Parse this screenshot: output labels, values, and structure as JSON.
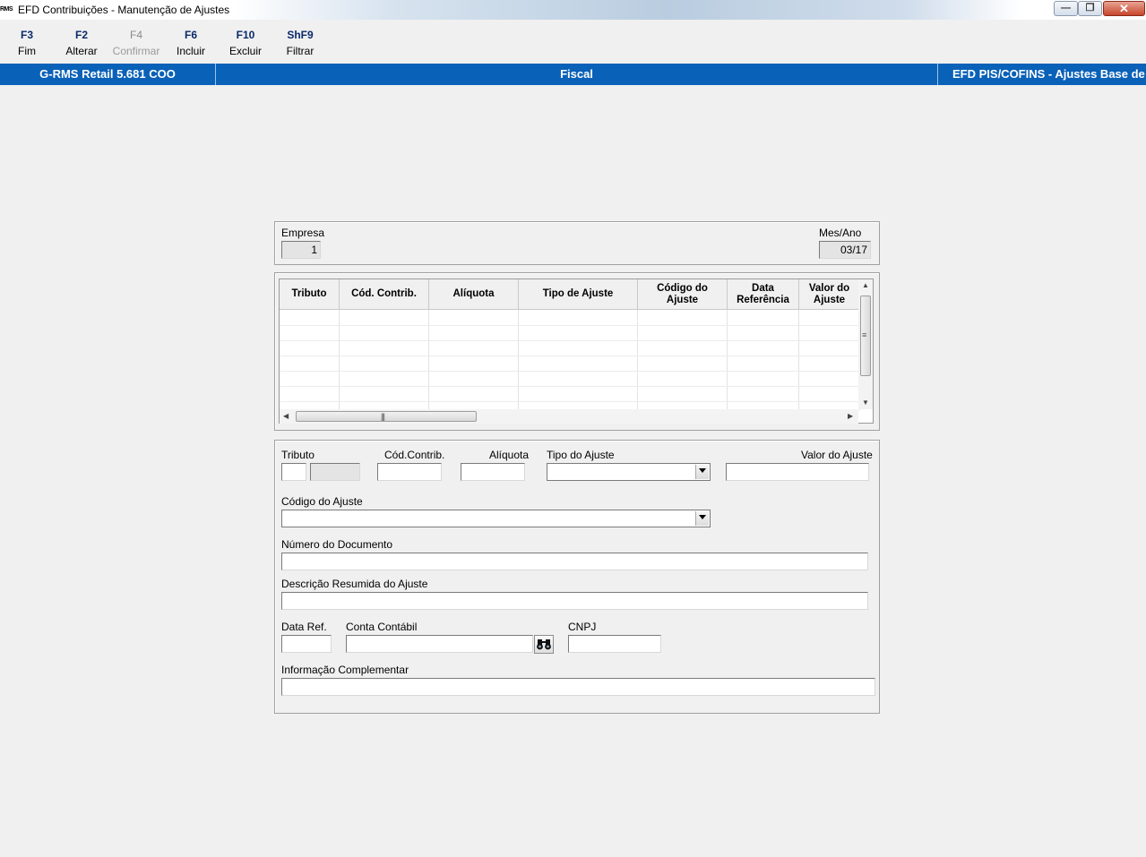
{
  "window": {
    "logo_text": "RMS",
    "title": "EFD Contribuições - Manutenção de Ajustes"
  },
  "toolbar": [
    {
      "key": "F3",
      "label": "Fim",
      "enabled": true
    },
    {
      "key": "F2",
      "label": "Alterar",
      "enabled": true
    },
    {
      "key": "F4",
      "label": "Confirmar",
      "enabled": false
    },
    {
      "key": "F6",
      "label": "Incluir",
      "enabled": true
    },
    {
      "key": "F10",
      "label": "Excluir",
      "enabled": true
    },
    {
      "key": "ShF9",
      "label": "Filtrar",
      "enabled": true
    }
  ],
  "header": {
    "app": "G-RMS Retail 5.681 COO",
    "module": "Fiscal",
    "screen": "EFD PIS/COFINS - Ajustes Base de"
  },
  "top_panel": {
    "empresa_label": "Empresa",
    "empresa_value": "1",
    "mes_ano_label": "Mes/Ano",
    "mes_ano_value": "03/17"
  },
  "grid": {
    "columns": [
      "Tributo",
      "Cód. Contrib.",
      "Alíquota",
      "Tipo de Ajuste",
      "Código do Ajuste",
      "Data Referência",
      "Valor do Ajuste"
    ],
    "rows": []
  },
  "form": {
    "tributo_label": "Tributo",
    "cod_contrib_label": "Cód.Contrib.",
    "aliquota_label": "Alíquota",
    "tipo_ajuste_label": "Tipo do Ajuste",
    "valor_ajuste_label": "Valor do Ajuste",
    "codigo_ajuste_label": "Código do Ajuste",
    "numero_documento_label": "Número do Documento",
    "descricao_label": "Descrição Resumida do Ajuste",
    "data_ref_label": "Data Ref.",
    "conta_contabil_label": "Conta Contábil",
    "cnpj_label": "CNPJ",
    "info_complementar_label": "Informação Complementar"
  }
}
